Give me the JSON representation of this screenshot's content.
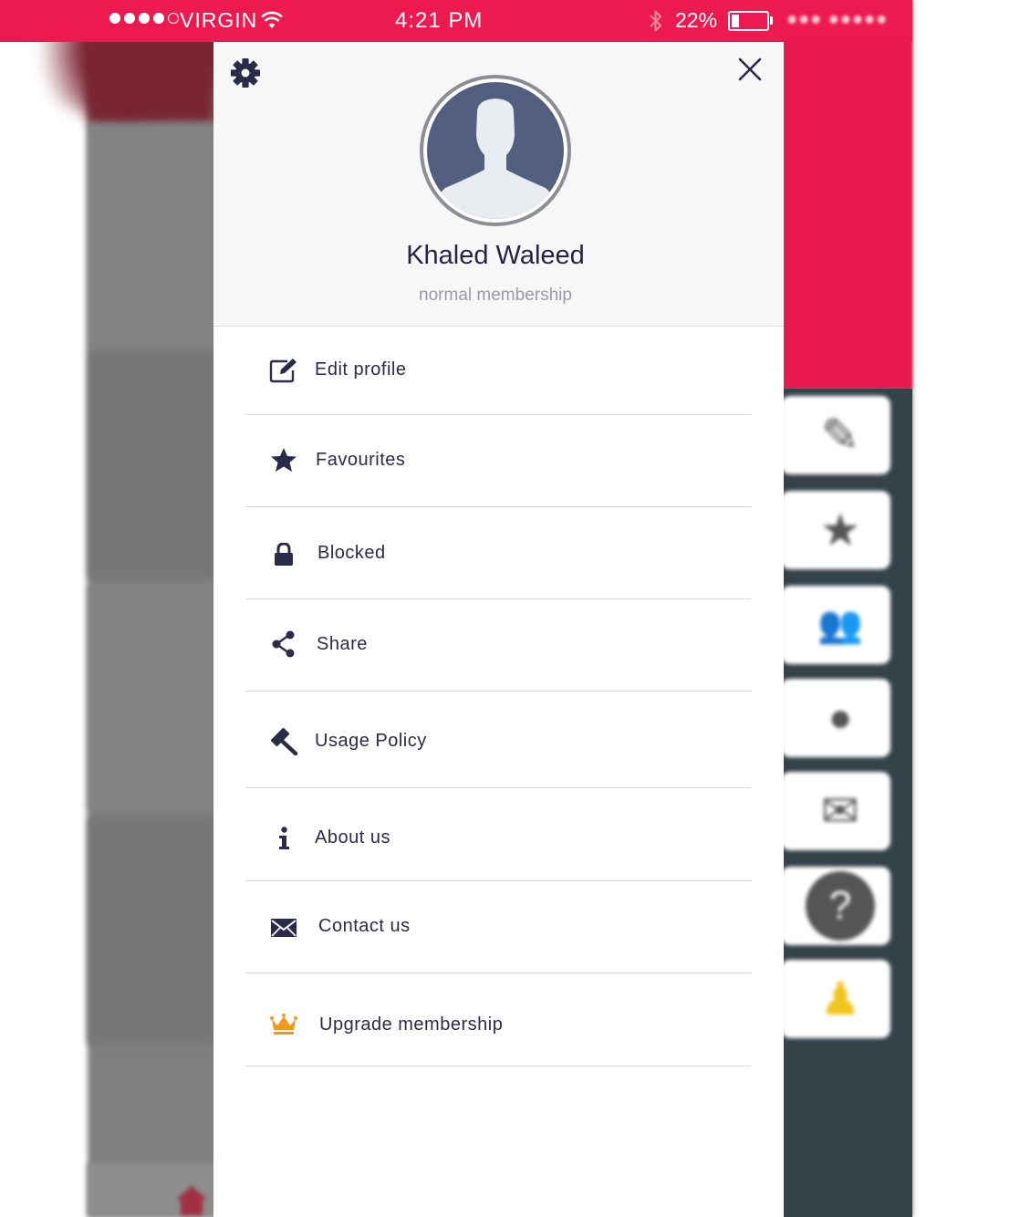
{
  "status_bar": {
    "signal_filled": 4,
    "signal_total": 5,
    "carrier": "VIRGIN",
    "time": "4:21 PM",
    "battery_percent": "22%",
    "battery_level": 0.22,
    "background_color": "#ed1a4f"
  },
  "drawer": {
    "settings_icon": "gear-icon",
    "close_icon": "close-icon",
    "profile": {
      "name": "Khaled Waleed",
      "membership": "normal membership",
      "avatar_icon": "person-silhouette-icon"
    },
    "menu": [
      {
        "id": "edit-profile",
        "label": "Edit profile",
        "icon": "edit-icon"
      },
      {
        "id": "favourites",
        "label": "Favourites",
        "icon": "star-icon"
      },
      {
        "id": "blocked",
        "label": "Blocked",
        "icon": "lock-icon"
      },
      {
        "id": "share",
        "label": "Share",
        "icon": "share-icon"
      },
      {
        "id": "usage-policy",
        "label": "Usage Policy",
        "icon": "gavel-icon"
      },
      {
        "id": "about-us",
        "label": "About us",
        "icon": "info-icon"
      },
      {
        "id": "contact-us",
        "label": "Contact us",
        "icon": "envelope-icon"
      },
      {
        "id": "upgrade-membership",
        "label": "Upgrade membership",
        "icon": "crown-icon"
      }
    ],
    "icon_color": "#2a2a4a",
    "crown_color": "#f39a1e"
  },
  "background_app": {
    "header_color": "#ed1a4f",
    "sidebar_color": "#34434a",
    "tiles": [
      "edit-icon",
      "star-icon",
      "group-icon",
      "bulb-icon",
      "envelope-icon",
      "question-icon",
      "user-badge-icon"
    ],
    "home_icon": "home-icon"
  }
}
